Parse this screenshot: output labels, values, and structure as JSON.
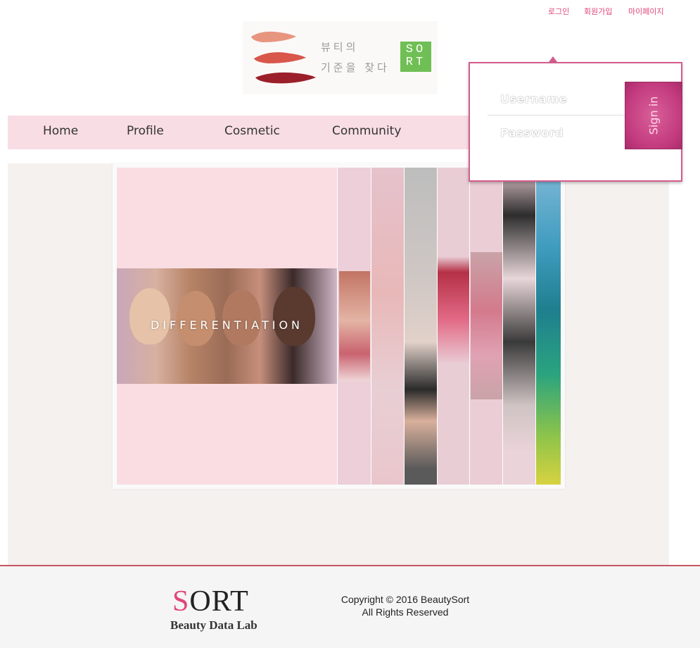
{
  "top_links": [
    "로그인",
    "회원가입",
    "마이페이지"
  ],
  "logo": {
    "line1": "뷰티의",
    "line2": "기준을 찾다",
    "sort_line1": "SO",
    "sort_line2": "RT"
  },
  "nav": {
    "items": [
      "Home",
      "Profile",
      "Cosmetic",
      "Community"
    ]
  },
  "hero": {
    "caption": "DIFFERENTIATION"
  },
  "login": {
    "username_placeholder": "Username",
    "password_placeholder": "Password",
    "signin_label": "Sign in"
  },
  "footer": {
    "brand_first": "S",
    "brand_rest": "ORT",
    "tagline": "Beauty Data Lab",
    "copyright_line1": "Copyright © 2016 BeautySort",
    "copyright_line2": "All Rights Reserved"
  },
  "colors": {
    "accent_pink": "#e0457b",
    "nav_bg": "#f8dde5",
    "signin_bg": "#c23a7e",
    "logo_green": "#6fbf54",
    "footer_rule": "#c6575f"
  }
}
